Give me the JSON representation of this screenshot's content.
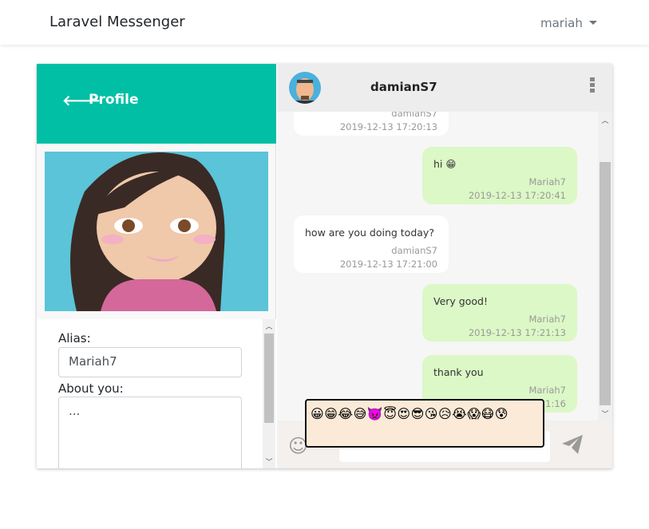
{
  "navbar": {
    "brand": "Laravel Messenger",
    "user": "mariah"
  },
  "profile": {
    "title": "Profile",
    "alias_label": "Alias:",
    "alias_value": "Mariah7",
    "about_label": "About you:",
    "about_value": "..."
  },
  "chat": {
    "contact": "damianS7",
    "messages": [
      {
        "side": "in",
        "text": "",
        "author": "damianS7",
        "time": "2019-12-13 17:20:13"
      },
      {
        "side": "out",
        "text": "hi 😁",
        "author": "Mariah7",
        "time": "2019-12-13 17:20:41"
      },
      {
        "side": "in",
        "text": "how are you doing today?",
        "author": "damianS7",
        "time": "2019-12-13 17:21:00"
      },
      {
        "side": "out",
        "text": "Very good!",
        "author": "Mariah7",
        "time": "2019-12-13 17:21:13"
      },
      {
        "side": "out",
        "text": "thank you",
        "author": "Mariah7",
        "time": "2019-12-13 17:21:16"
      }
    ],
    "message_input": "",
    "emojis": [
      "😀",
      "😁",
      "😂",
      "😅",
      "👿",
      "😇",
      "😍",
      "😎",
      "😘",
      "😥",
      "😭",
      "😱",
      "😷",
      "😰"
    ]
  },
  "colors": {
    "accent": "#00bfa5",
    "outgoing_bubble": "#dcf8c6",
    "emoji_panel": "#fbead7"
  }
}
